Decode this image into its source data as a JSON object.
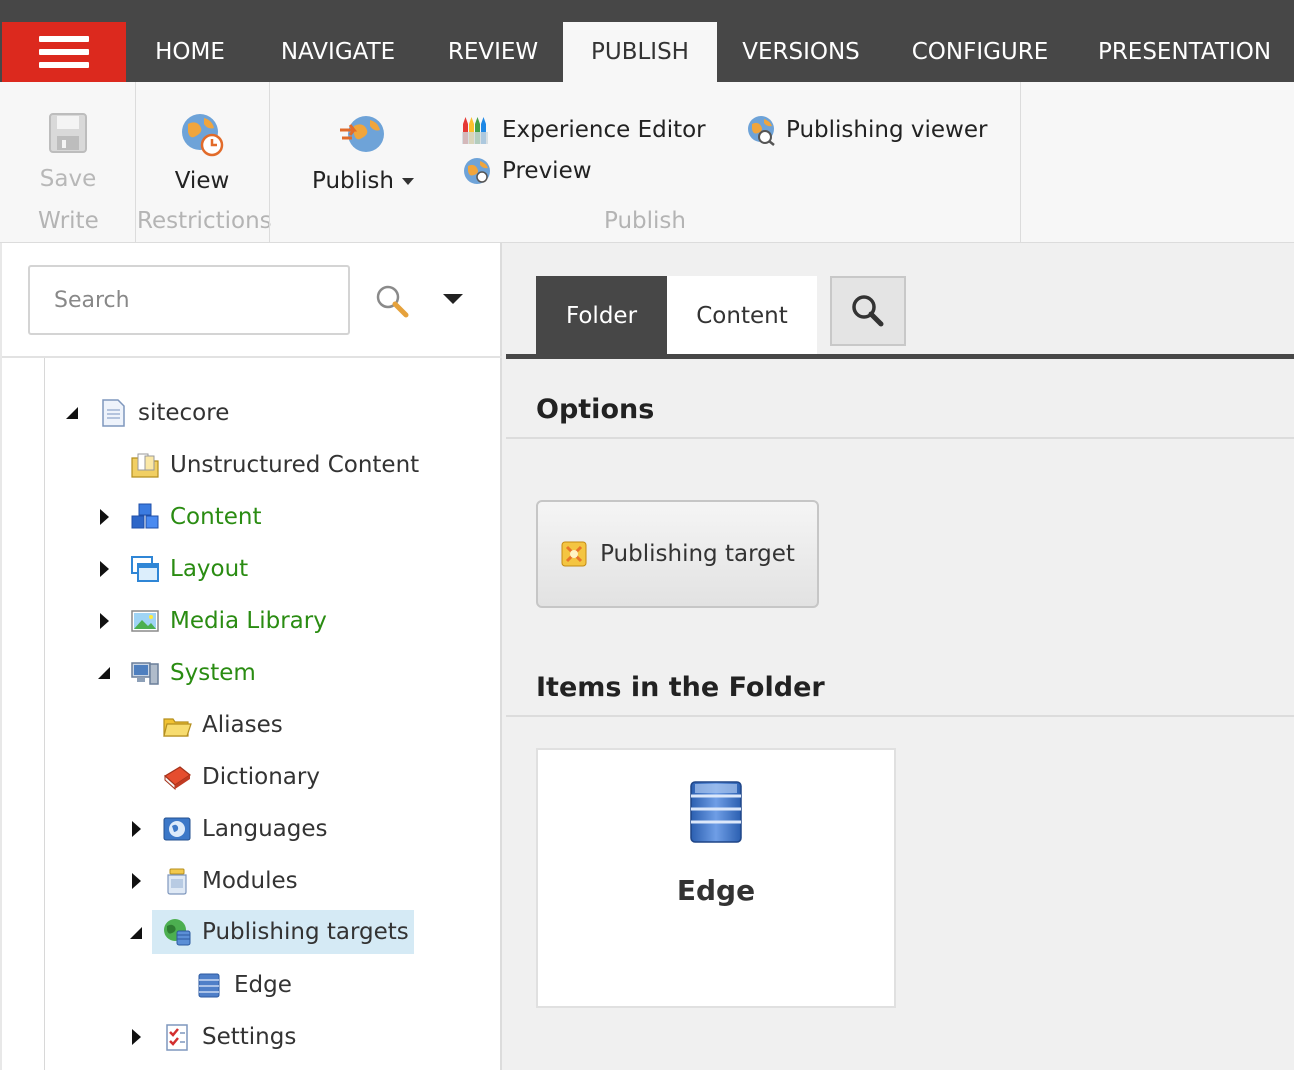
{
  "topnav": {
    "tabs": [
      "HOME",
      "NAVIGATE",
      "REVIEW",
      "PUBLISH",
      "VERSIONS",
      "CONFIGURE",
      "PRESENTATION"
    ],
    "active": "PUBLISH"
  },
  "ribbon": {
    "save_label": "Save",
    "write_group": "Write",
    "view_label": "View",
    "restrictions_group": "Restrictions",
    "publish_label": "Publish",
    "experience_editor": "Experience Editor",
    "preview": "Preview",
    "publishing_viewer": "Publishing viewer",
    "publish_group": "Publish"
  },
  "search": {
    "placeholder": "Search"
  },
  "tree": {
    "root": "sitecore",
    "unstructured": "Unstructured Content",
    "content": "Content",
    "layout": "Layout",
    "media": "Media Library",
    "system": "System",
    "aliases": "Aliases",
    "dictionary": "Dictionary",
    "languages": "Languages",
    "modules": "Modules",
    "publishing_targets": "Publishing targets",
    "edge": "Edge",
    "settings": "Settings"
  },
  "content_tabs": {
    "folder": "Folder",
    "content": "Content"
  },
  "options": {
    "title": "Options",
    "publishing_target": "Publishing target"
  },
  "items": {
    "title": "Items in the Folder",
    "edge": "Edge"
  },
  "colors": {
    "topbar": "#474747",
    "menu_red": "#dc291e",
    "tree_green": "#2a8c12",
    "selection": "#d5eaf5"
  }
}
